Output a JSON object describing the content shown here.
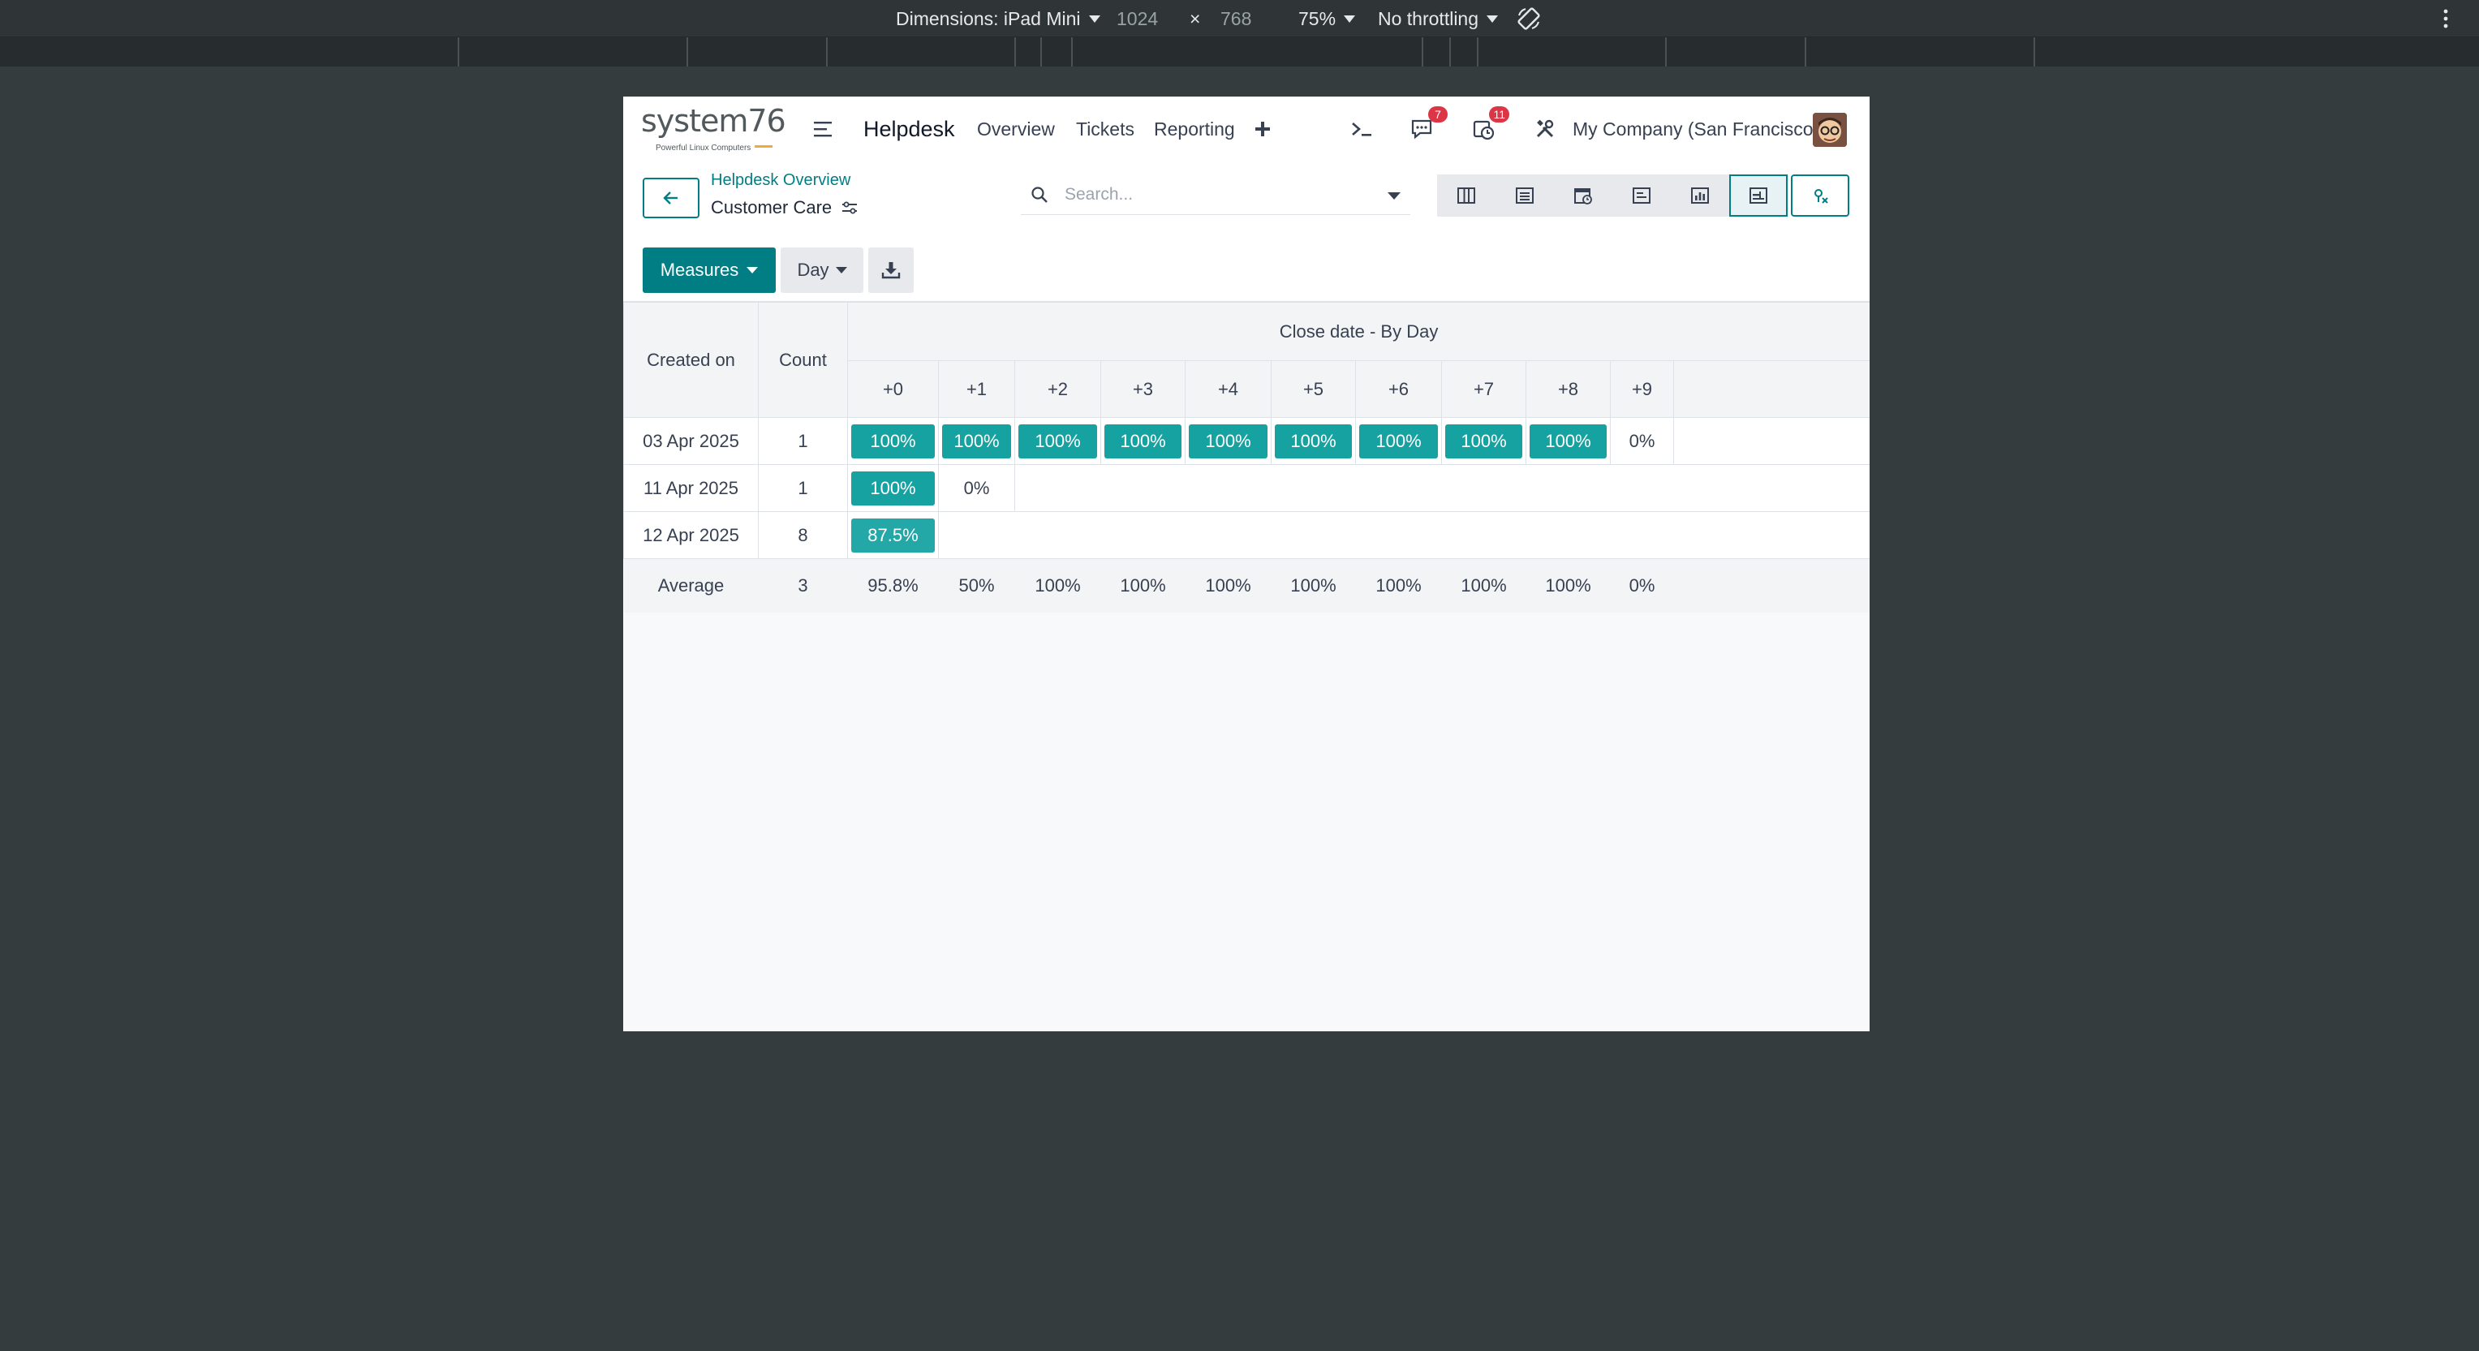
{
  "devtools": {
    "dimensions_label": "Dimensions: iPad Mini",
    "width": "1024",
    "times": "×",
    "height": "768",
    "zoom": "75%",
    "throttling": "No throttling"
  },
  "navbar": {
    "logo_text": "system76",
    "logo_tagline": "Powerful Linux Computers",
    "app_title": "Helpdesk",
    "menu": [
      "Overview",
      "Tickets",
      "Reporting"
    ],
    "messages_badge": "7",
    "activities_badge": "11",
    "company": "My Company (San Francisco)"
  },
  "breadcrumb": {
    "parent": "Helpdesk Overview",
    "current": "Customer Care"
  },
  "search": {
    "placeholder": "Search..."
  },
  "toolbar": {
    "measures_label": "Measures",
    "interval_label": "Day"
  },
  "cohort": {
    "row_header": "Created on",
    "count_header": "Count",
    "group_header": "Close date - By Day",
    "columns": [
      "+0",
      "+1",
      "+2",
      "+3",
      "+4",
      "+5",
      "+6",
      "+7",
      "+8",
      "+9"
    ],
    "accent_color": "#17a2a2",
    "rows": [
      {
        "date": "03 Apr 2025",
        "count": "1",
        "values": [
          "100%",
          "100%",
          "100%",
          "100%",
          "100%",
          "100%",
          "100%",
          "100%",
          "100%",
          "0%"
        ],
        "levels": [
          1,
          1,
          1,
          1,
          1,
          1,
          1,
          1,
          1,
          0
        ]
      },
      {
        "date": "11 Apr 2025",
        "count": "1",
        "values": [
          "100%",
          "0%"
        ],
        "levels": [
          1,
          0
        ]
      },
      {
        "date": "12 Apr 2025",
        "count": "8",
        "values": [
          "87.5%"
        ],
        "levels": [
          0.875
        ]
      }
    ],
    "average": {
      "label": "Average",
      "count": "3",
      "values": [
        "95.8%",
        "50%",
        "100%",
        "100%",
        "100%",
        "100%",
        "100%",
        "100%",
        "100%",
        "0%"
      ]
    }
  }
}
